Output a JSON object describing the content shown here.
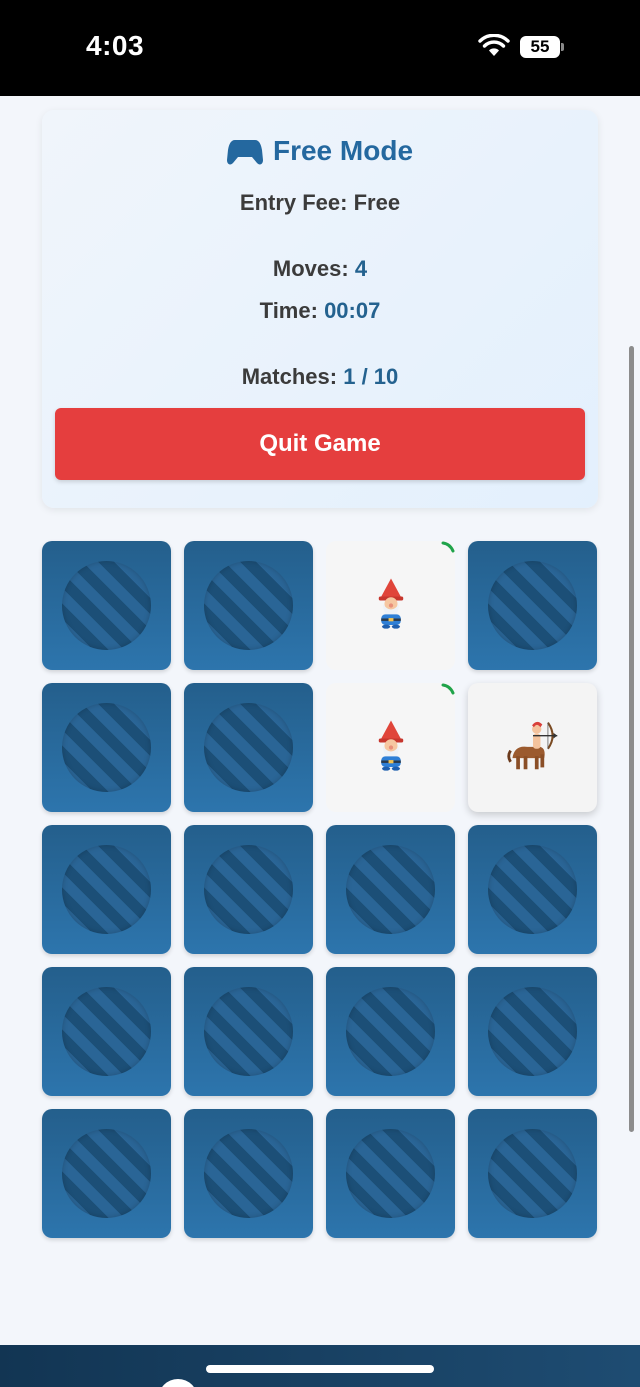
{
  "status_bar": {
    "time": "4:03",
    "battery": "55"
  },
  "game": {
    "mode_title": "Free Mode",
    "fee_label": "Entry Fee:",
    "fee_value": "Free",
    "moves_label": "Moves:",
    "moves_value": "4",
    "time_label": "Time:",
    "time_value": "00:07",
    "matches_label": "Matches:",
    "matches_value": "1 / 10",
    "quit_label": "Quit Game"
  },
  "grid": {
    "columns": 4,
    "rows": 5,
    "cards": [
      {
        "state": "back"
      },
      {
        "state": "back"
      },
      {
        "state": "matched",
        "face": "gnome"
      },
      {
        "state": "back"
      },
      {
        "state": "back"
      },
      {
        "state": "back"
      },
      {
        "state": "matched",
        "face": "gnome"
      },
      {
        "state": "flipped",
        "face": "sagittarius"
      },
      {
        "state": "back"
      },
      {
        "state": "back"
      },
      {
        "state": "back"
      },
      {
        "state": "back"
      },
      {
        "state": "back"
      },
      {
        "state": "back"
      },
      {
        "state": "back"
      },
      {
        "state": "back"
      },
      {
        "state": "back"
      },
      {
        "state": "back"
      },
      {
        "state": "back"
      },
      {
        "state": "back"
      }
    ]
  },
  "colors": {
    "accent": "#24689f",
    "quit_button": "#e53e3e",
    "card_back": "#2a6a9e",
    "match_indicator": "#1fa34a"
  },
  "icons": {
    "mode": "gamepad-icon",
    "wifi": "wifi-icon",
    "battery": "battery-icon"
  }
}
